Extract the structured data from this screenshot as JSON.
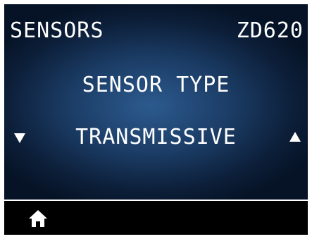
{
  "header": {
    "title": "SENSORS",
    "model": "ZD620"
  },
  "setting": {
    "label": "SENSOR TYPE",
    "value": "TRANSMISSIVE"
  },
  "icons": {
    "prev": "down-arrow-icon",
    "next": "up-arrow-icon",
    "home": "home-icon"
  },
  "colors": {
    "background_center": "#2c5a8e",
    "background_edge": "#061326",
    "text": "#ffffff",
    "footer": "#000000"
  }
}
